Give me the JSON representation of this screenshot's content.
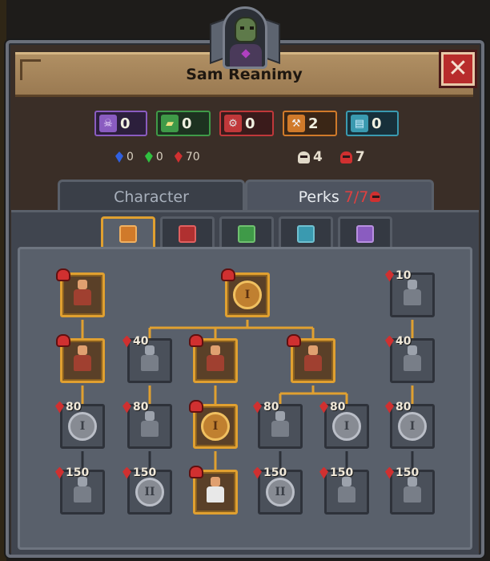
{
  "character": {
    "name": "Sam Reanimy"
  },
  "currencies": [
    {
      "icon": "skull-token-icon",
      "value": "0",
      "color": "#8a5cc0"
    },
    {
      "icon": "bread-token-icon",
      "value": "0",
      "color": "#3f9a48"
    },
    {
      "icon": "gear-token-icon",
      "value": "0",
      "color": "#c0383a"
    },
    {
      "icon": "hammer-token-icon",
      "value": "2",
      "color": "#d07a2a"
    },
    {
      "icon": "book-token-icon",
      "value": "0",
      "color": "#3a9ab0"
    }
  ],
  "gems": {
    "blue": "0",
    "green": "0",
    "red": "70"
  },
  "skulls": {
    "white": "4",
    "red": "7"
  },
  "tabs": {
    "character": "Character",
    "perks": "Perks",
    "perks_count": "7/7"
  },
  "subtabs": [
    {
      "icon": "hammer-icon",
      "active": true
    },
    {
      "icon": "gear-icon",
      "active": false
    },
    {
      "icon": "bread-icon",
      "active": false
    },
    {
      "icon": "book-icon",
      "active": false
    },
    {
      "icon": "skull-icon",
      "active": false
    }
  ],
  "tree": {
    "costs": {
      "right_top": "10",
      "c1r1": "40",
      "c5r1": "40",
      "c0r2": "80",
      "c1r2": "80",
      "c3r2": "80",
      "c4r2": "80",
      "c5r2": "80",
      "c0r3": "150",
      "c1r3": "150",
      "c3r3": "150",
      "c4r3": "150",
      "c5r3": "150"
    },
    "coin_labels": {
      "top": "I",
      "c0r2": "I",
      "c2r2": "I",
      "c4r2": "I",
      "c5r2": "I",
      "c1r3": "II",
      "c3r3": "II"
    }
  }
}
